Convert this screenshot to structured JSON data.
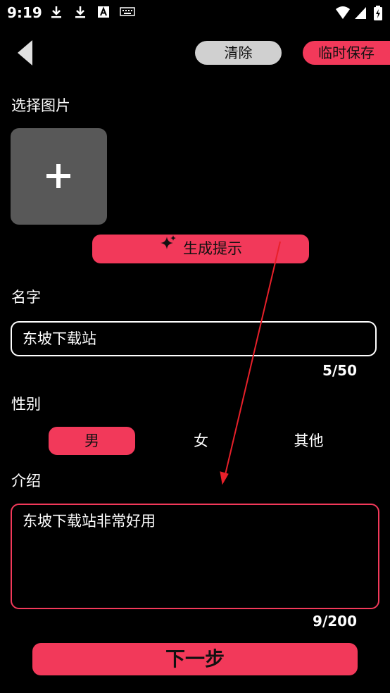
{
  "status_bar": {
    "time": "9:19",
    "icons": [
      "download-icon",
      "download-icon",
      "text-a-icon",
      "keyboard-icon",
      "wifi-icon",
      "signal-icon",
      "battery-charging-icon"
    ]
  },
  "header": {
    "back_icon": "back-triangle-icon",
    "clear_label": "清除",
    "temp_save_label": "临时保存"
  },
  "image_section": {
    "label": "选择图片",
    "add_icon": "plus-icon"
  },
  "generate": {
    "icon": "sparkle-icon",
    "label": "生成提示"
  },
  "name_section": {
    "label": "名字",
    "value": "东坡下载站",
    "counter": "5/50"
  },
  "gender_section": {
    "label": "性别",
    "options": [
      {
        "label": "男",
        "selected": true
      },
      {
        "label": "女",
        "selected": false
      },
      {
        "label": "其他",
        "selected": false
      }
    ]
  },
  "intro_section": {
    "label": "介绍",
    "value": "东坡下载站非常好用",
    "counter": "9/200"
  },
  "next_label": "下一步",
  "colors": {
    "accent": "#f2395a",
    "background": "#000000",
    "clear_button": "#d0d0d0",
    "image_picker": "#585858",
    "annotation": "#e8202a"
  }
}
